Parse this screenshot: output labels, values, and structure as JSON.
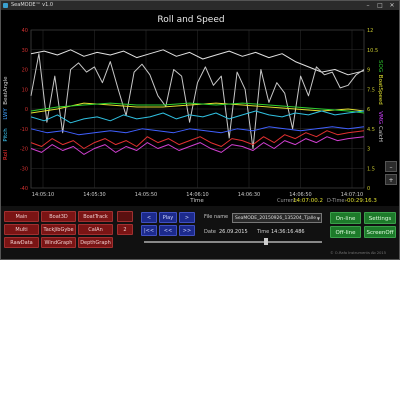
{
  "window": {
    "title": "SeaMODE™ v1.0",
    "minimize": "–",
    "maximize": "□",
    "close": "✕"
  },
  "chart_data": {
    "type": "line",
    "title": "Roll and Speed",
    "xlabel": "Time",
    "x_ticks": [
      "14:05:10",
      "14:05:30",
      "14:05:50",
      "14:06:10",
      "14:06:30",
      "14:06:50",
      "14:07:10"
    ],
    "x_range": [
      0,
      126
    ],
    "left_axis": {
      "labels": [
        "Roll",
        "Pitch",
        "LWY",
        "BeatAngle"
      ],
      "label_colors": [
        "#ff3030",
        "#40d0ff",
        "#40a0ff",
        "#d0d0d0"
      ],
      "ticks": [
        40,
        30,
        20,
        10,
        0,
        -10,
        -20,
        -30,
        -40
      ],
      "range": [
        -40,
        40
      ]
    },
    "right_axis": {
      "labels": [
        "SOG",
        "BoatSpeed",
        "VMG",
        "CalcH"
      ],
      "label_colors": [
        "#30d030",
        "#e0e030",
        "#d040ff",
        "#d0d0d0"
      ],
      "ticks": [
        12,
        10.5,
        9,
        7.5,
        6,
        4.5,
        3,
        1.5,
        0
      ],
      "range": [
        0,
        12
      ]
    },
    "series": [
      {
        "color": "#e0e0e0",
        "axis": "right",
        "x": [
          0,
          5,
          10,
          15,
          20,
          25,
          30,
          35,
          40,
          45,
          50,
          55,
          60,
          65,
          70,
          75,
          80,
          85,
          90,
          95,
          100,
          105,
          110,
          115,
          120,
          126
        ],
        "values": [
          10.2,
          10.4,
          10.1,
          10.5,
          10.0,
          10.3,
          10.1,
          10.4,
          9.9,
          10.2,
          10.5,
          10.0,
          10.3,
          9.8,
          10.1,
          10.4,
          10.0,
          10.3,
          9.9,
          10.2,
          9.6,
          9.2,
          8.8,
          9.0,
          8.6,
          8.9
        ]
      },
      {
        "color": "#c8c8c8",
        "axis": "right",
        "x": [
          0,
          3,
          6,
          9,
          12,
          15,
          18,
          21,
          24,
          27,
          30,
          33,
          36,
          39,
          42,
          45,
          48,
          51,
          54,
          57,
          60,
          63,
          66,
          69,
          72,
          75,
          78,
          81,
          84,
          87,
          90,
          93,
          96,
          99,
          102,
          105,
          108,
          111,
          114,
          117,
          120,
          123,
          126
        ],
        "values": [
          7.0,
          10.2,
          5.0,
          8.5,
          4.2,
          9.0,
          9.5,
          8.8,
          9.2,
          8.0,
          9.6,
          7.5,
          5.5,
          8.8,
          9.4,
          8.6,
          7.0,
          6.2,
          9.0,
          8.5,
          5.0,
          8.0,
          9.2,
          7.8,
          8.5,
          3.8,
          8.8,
          7.5,
          3.0,
          9.0,
          6.5,
          8.0,
          7.2,
          4.5,
          8.5,
          7.0,
          9.2,
          8.6,
          8.8,
          7.6,
          7.8,
          8.6,
          9.0
        ]
      },
      {
        "color": "#e0e030",
        "axis": "left",
        "x": [
          0,
          10,
          20,
          30,
          40,
          50,
          60,
          70,
          80,
          90,
          100,
          110,
          120,
          126
        ],
        "values": [
          -2,
          0,
          3,
          2,
          1,
          1,
          2,
          3,
          2,
          1,
          0,
          -1,
          0,
          -1
        ]
      },
      {
        "color": "#30d030",
        "axis": "left",
        "x": [
          0,
          10,
          20,
          30,
          40,
          50,
          60,
          70,
          80,
          90,
          100,
          110,
          120,
          126
        ],
        "values": [
          -1,
          1,
          2,
          3,
          2,
          2,
          3,
          2,
          3,
          2,
          1,
          0,
          -1,
          -2
        ]
      },
      {
        "color": "#30c0e0",
        "axis": "left",
        "x": [
          0,
          5,
          10,
          15,
          20,
          25,
          30,
          35,
          40,
          45,
          50,
          55,
          60,
          65,
          70,
          75,
          80,
          85,
          90,
          95,
          100,
          105,
          110,
          115,
          120,
          126
        ],
        "values": [
          -4,
          -6,
          -3,
          -7,
          -5,
          -4,
          -6,
          -3,
          -5,
          -4,
          -2,
          -5,
          -3,
          -4,
          -2,
          -5,
          -3,
          -1,
          -3,
          -4,
          -2,
          -3,
          -1,
          -3,
          -2,
          -1
        ]
      },
      {
        "color": "#4060ff",
        "axis": "left",
        "x": [
          0,
          6,
          12,
          18,
          24,
          30,
          36,
          42,
          48,
          54,
          60,
          66,
          72,
          78,
          84,
          90,
          96,
          102,
          108,
          114,
          120,
          126
        ],
        "values": [
          -10,
          -12,
          -11,
          -13,
          -12,
          -11,
          -12,
          -10,
          -11,
          -12,
          -10,
          -11,
          -12,
          -10,
          -11,
          -9,
          -10,
          -11,
          -10,
          -9,
          -10,
          -9
        ]
      },
      {
        "color": "#e03030",
        "axis": "left",
        "x": [
          0,
          4,
          8,
          12,
          16,
          20,
          24,
          28,
          32,
          36,
          40,
          44,
          48,
          52,
          56,
          60,
          64,
          68,
          72,
          76,
          80,
          84,
          88,
          92,
          96,
          100,
          104,
          108,
          112,
          116,
          120,
          126
        ],
        "values": [
          -17,
          -19,
          -15,
          -18,
          -16,
          -20,
          -17,
          -15,
          -18,
          -16,
          -19,
          -14,
          -17,
          -15,
          -18,
          -16,
          -14,
          -17,
          -19,
          -15,
          -16,
          -18,
          -14,
          -17,
          -13,
          -15,
          -12,
          -14,
          -11,
          -13,
          -12,
          -11
        ]
      },
      {
        "color": "#d040d0",
        "axis": "left",
        "x": [
          0,
          4,
          8,
          12,
          16,
          20,
          24,
          28,
          32,
          36,
          40,
          44,
          48,
          52,
          56,
          60,
          64,
          68,
          72,
          76,
          80,
          84,
          88,
          92,
          96,
          100,
          104,
          108,
          112,
          116,
          120,
          126
        ],
        "values": [
          -20,
          -22,
          -18,
          -21,
          -19,
          -23,
          -20,
          -18,
          -22,
          -19,
          -21,
          -17,
          -20,
          -18,
          -21,
          -19,
          -17,
          -20,
          -22,
          -18,
          -19,
          -21,
          -17,
          -20,
          -16,
          -18,
          -15,
          -17,
          -14,
          -16,
          -15,
          -14
        ]
      }
    ]
  },
  "status": {
    "current_label": "Current:",
    "current_value": "14:07:00.2",
    "dtime_label": "D-Time:",
    "dtime_value": "-00:29:16.3"
  },
  "nav_buttons": [
    {
      "label": "Main"
    },
    {
      "label": "Boat3D"
    },
    {
      "label": "BoatTrack"
    },
    {
      "label": "Multi"
    },
    {
      "label": "TackJibGybe"
    },
    {
      "label": "CalAn"
    },
    {
      "label": "RawData"
    },
    {
      "label": "WindGraph"
    },
    {
      "label": "DepthGraph"
    }
  ],
  "aux_buttons": {
    "top": "",
    "page": "2"
  },
  "playback": {
    "back": "<",
    "play": "Play",
    "forward": ">",
    "rewind": "|<<",
    "step_back": "<<",
    "step_forward": ">>"
  },
  "file": {
    "label": "File name",
    "value": "SeaMODE_20150926_135204_Tjalle",
    "date_label": "Date",
    "date_value": "26.09.2015",
    "time_label": "Time",
    "time_value": "14:36:16.486"
  },
  "right_buttons": {
    "online": "On-line",
    "settings": "Settings",
    "offline": "Off-line",
    "screen_off": "ScreenOff"
  },
  "side_buttons": {
    "minus": "–",
    "plus": "+"
  },
  "copyright": "© O-Rafo Instruments Ab 2015"
}
